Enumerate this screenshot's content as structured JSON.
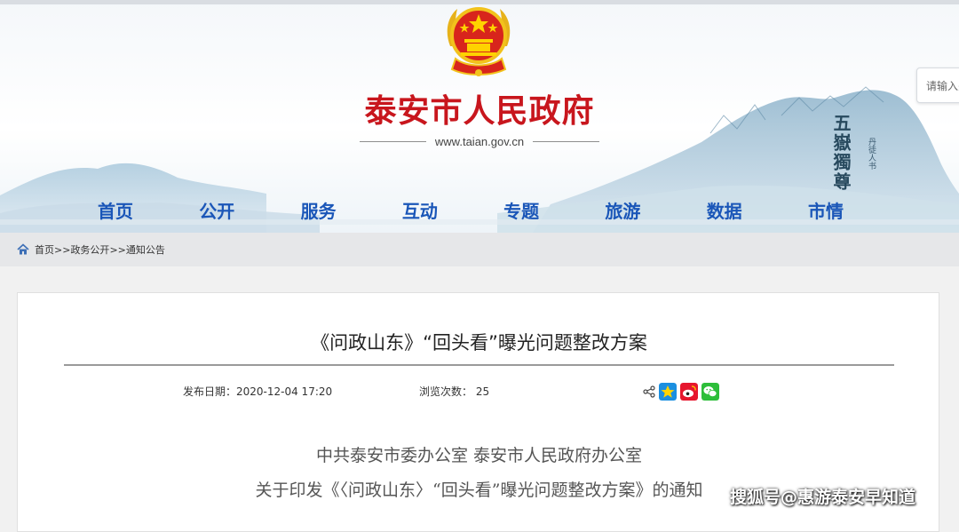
{
  "header": {
    "site_title": "泰安市人民政府",
    "site_url": "www.taian.gov.cn",
    "calligraphy_main": "五嶽獨尊",
    "calligraphy_small": "丹徒人书",
    "search_placeholder": "请输入关"
  },
  "nav": {
    "items": [
      {
        "label": "首页"
      },
      {
        "label": "公开"
      },
      {
        "label": "服务"
      },
      {
        "label": "互动"
      },
      {
        "label": "专题"
      },
      {
        "label": "旅游"
      },
      {
        "label": "数据"
      },
      {
        "label": "市情"
      }
    ]
  },
  "breadcrumb": {
    "items": [
      "首页",
      "政务公开",
      "通知公告"
    ],
    "separator": ">>"
  },
  "article": {
    "title": "《问政山东》“回头看”曝光问题整改方案",
    "publish_date": "发布日期：2020-12-04 17:20",
    "views": "浏览次数： 25",
    "body_line1": "中共泰安市委办公室  泰安市人民政府办公室",
    "body_line2": "关于印发《〈问政山东〉“回头看”曝光问题整改方案》的通知"
  },
  "watermark": "搜狐号@惠游泰安早知道",
  "colors": {
    "title_red": "#c8161d",
    "nav_blue": "#1a56b8",
    "breadcrumb_bg": "#e6e7e9"
  },
  "icons": [
    "national-emblem",
    "home-icon",
    "share-icon",
    "qzone-icon",
    "weibo-icon",
    "wechat-icon"
  ]
}
